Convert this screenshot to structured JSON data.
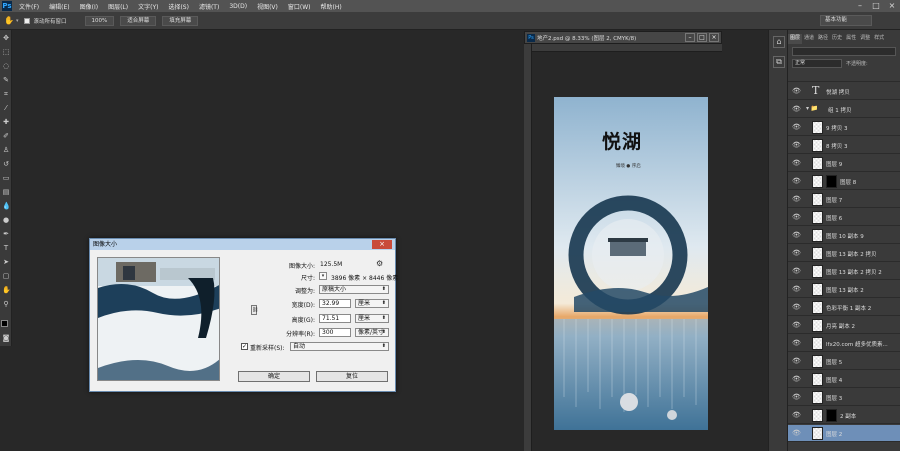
{
  "app": {
    "logo": "Ps"
  },
  "menu": [
    "文件(F)",
    "编辑(E)",
    "图像(I)",
    "图层(L)",
    "文字(Y)",
    "选择(S)",
    "滤镜(T)",
    "3D(D)",
    "视图(V)",
    "窗口(W)",
    "帮助(H)"
  ],
  "options": {
    "scroll_all_label": "滚动所有窗口",
    "btn_100": "100%",
    "btn_fit": "适合屏幕",
    "btn_fill": "填充屏幕",
    "workspace": "基本功能"
  },
  "document": {
    "tab_title": "地产2.psd @ 8.33% (图层 2, CMYK/8)",
    "poster_title": "悦湖",
    "poster_sub": "臻境 ● 序启"
  },
  "dialog": {
    "title": "图像大小",
    "image_size_label": "图像大小:",
    "image_size_value": "125.5M",
    "dimensions_label": "尺寸:",
    "dimensions_value": "3896 像素 × 8446 像素",
    "fit_to_label": "调整为:",
    "fit_to_value": "原稿大小",
    "width_label": "宽度(D):",
    "width_value": "32.99",
    "width_unit": "厘米",
    "height_label": "高度(G):",
    "height_value": "71.51",
    "height_unit": "厘米",
    "resolution_label": "分辨率(R):",
    "resolution_value": "300",
    "resolution_unit": "像素/英寸",
    "resample_label": "重新采样(S):",
    "resample_value": "自动",
    "ok": "确定",
    "reset": "复位"
  },
  "layers_panel": {
    "tabs": [
      "图层",
      "通道",
      "路径",
      "历史",
      "属性",
      "调整",
      "样式"
    ],
    "blend_mode": "正常",
    "opacity_label": "不透明度:",
    "items": [
      {
        "name": "悦湖 拷贝",
        "type": "text"
      },
      {
        "name": "组 1 拷贝",
        "type": "group"
      },
      {
        "name": "9 拷贝 3",
        "type": "layer"
      },
      {
        "name": "8 拷贝 3",
        "type": "layer"
      },
      {
        "name": "图层 9",
        "type": "layer"
      },
      {
        "name": "图层 8",
        "type": "masked"
      },
      {
        "name": "图层 7",
        "type": "layer"
      },
      {
        "name": "图层 6",
        "type": "layer"
      },
      {
        "name": "图层 10 副本 9",
        "type": "layer"
      },
      {
        "name": "图层 13 副本 2 拷贝",
        "type": "layer"
      },
      {
        "name": "图层 13 副本 2 拷贝 2",
        "type": "layer"
      },
      {
        "name": "图层 13 副本 2",
        "type": "layer"
      },
      {
        "name": "色彩平衡 1 副本 2",
        "type": "layer"
      },
      {
        "name": "月亮 副本 2",
        "type": "layer"
      },
      {
        "name": "lfx20.com 超多优质素...",
        "type": "layer"
      },
      {
        "name": "图层 5",
        "type": "layer"
      },
      {
        "name": "图层 4",
        "type": "layer"
      },
      {
        "name": "图层 3",
        "type": "layer"
      },
      {
        "name": "2 副本",
        "type": "masked"
      },
      {
        "name": "图层 2",
        "type": "layer",
        "selected": true
      }
    ]
  }
}
